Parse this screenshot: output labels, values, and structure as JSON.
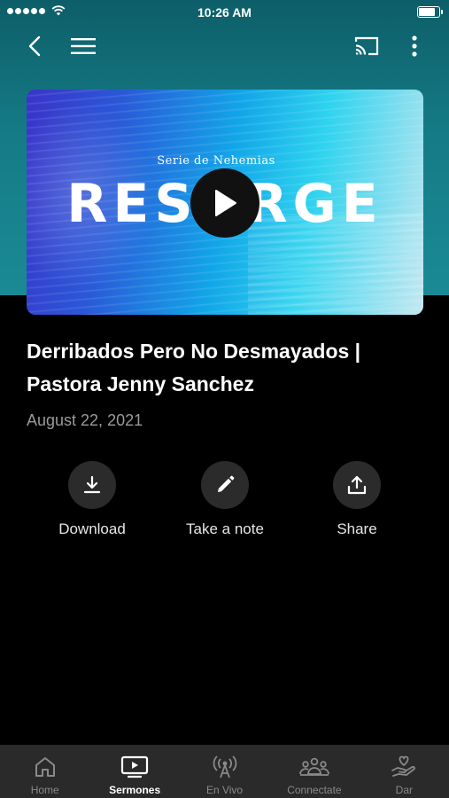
{
  "status_bar": {
    "time": "10:26 AM"
  },
  "video": {
    "series_label": "Serie de Nehemias",
    "series_title": "RESURGE"
  },
  "sermon": {
    "title": "Derribados Pero No Desmayados | Pastora Jenny Sanchez",
    "date": "August 22, 2021"
  },
  "actions": {
    "download": "Download",
    "note": "Take a note",
    "share": "Share"
  },
  "tabs": [
    {
      "label": "Home",
      "icon": "home-icon",
      "active": false
    },
    {
      "label": "Sermones",
      "icon": "tv-play-icon",
      "active": true
    },
    {
      "label": "En Vivo",
      "icon": "broadcast-icon",
      "active": false
    },
    {
      "label": "Connectate",
      "icon": "people-icon",
      "active": false
    },
    {
      "label": "Dar",
      "icon": "heart-hand-icon",
      "active": false
    }
  ],
  "colors": {
    "hero": "#157b86",
    "background": "#000000",
    "tab_bar": "#2a2a2a",
    "action_circle": "#2b2b2b",
    "date_text": "#9a9a9a"
  }
}
